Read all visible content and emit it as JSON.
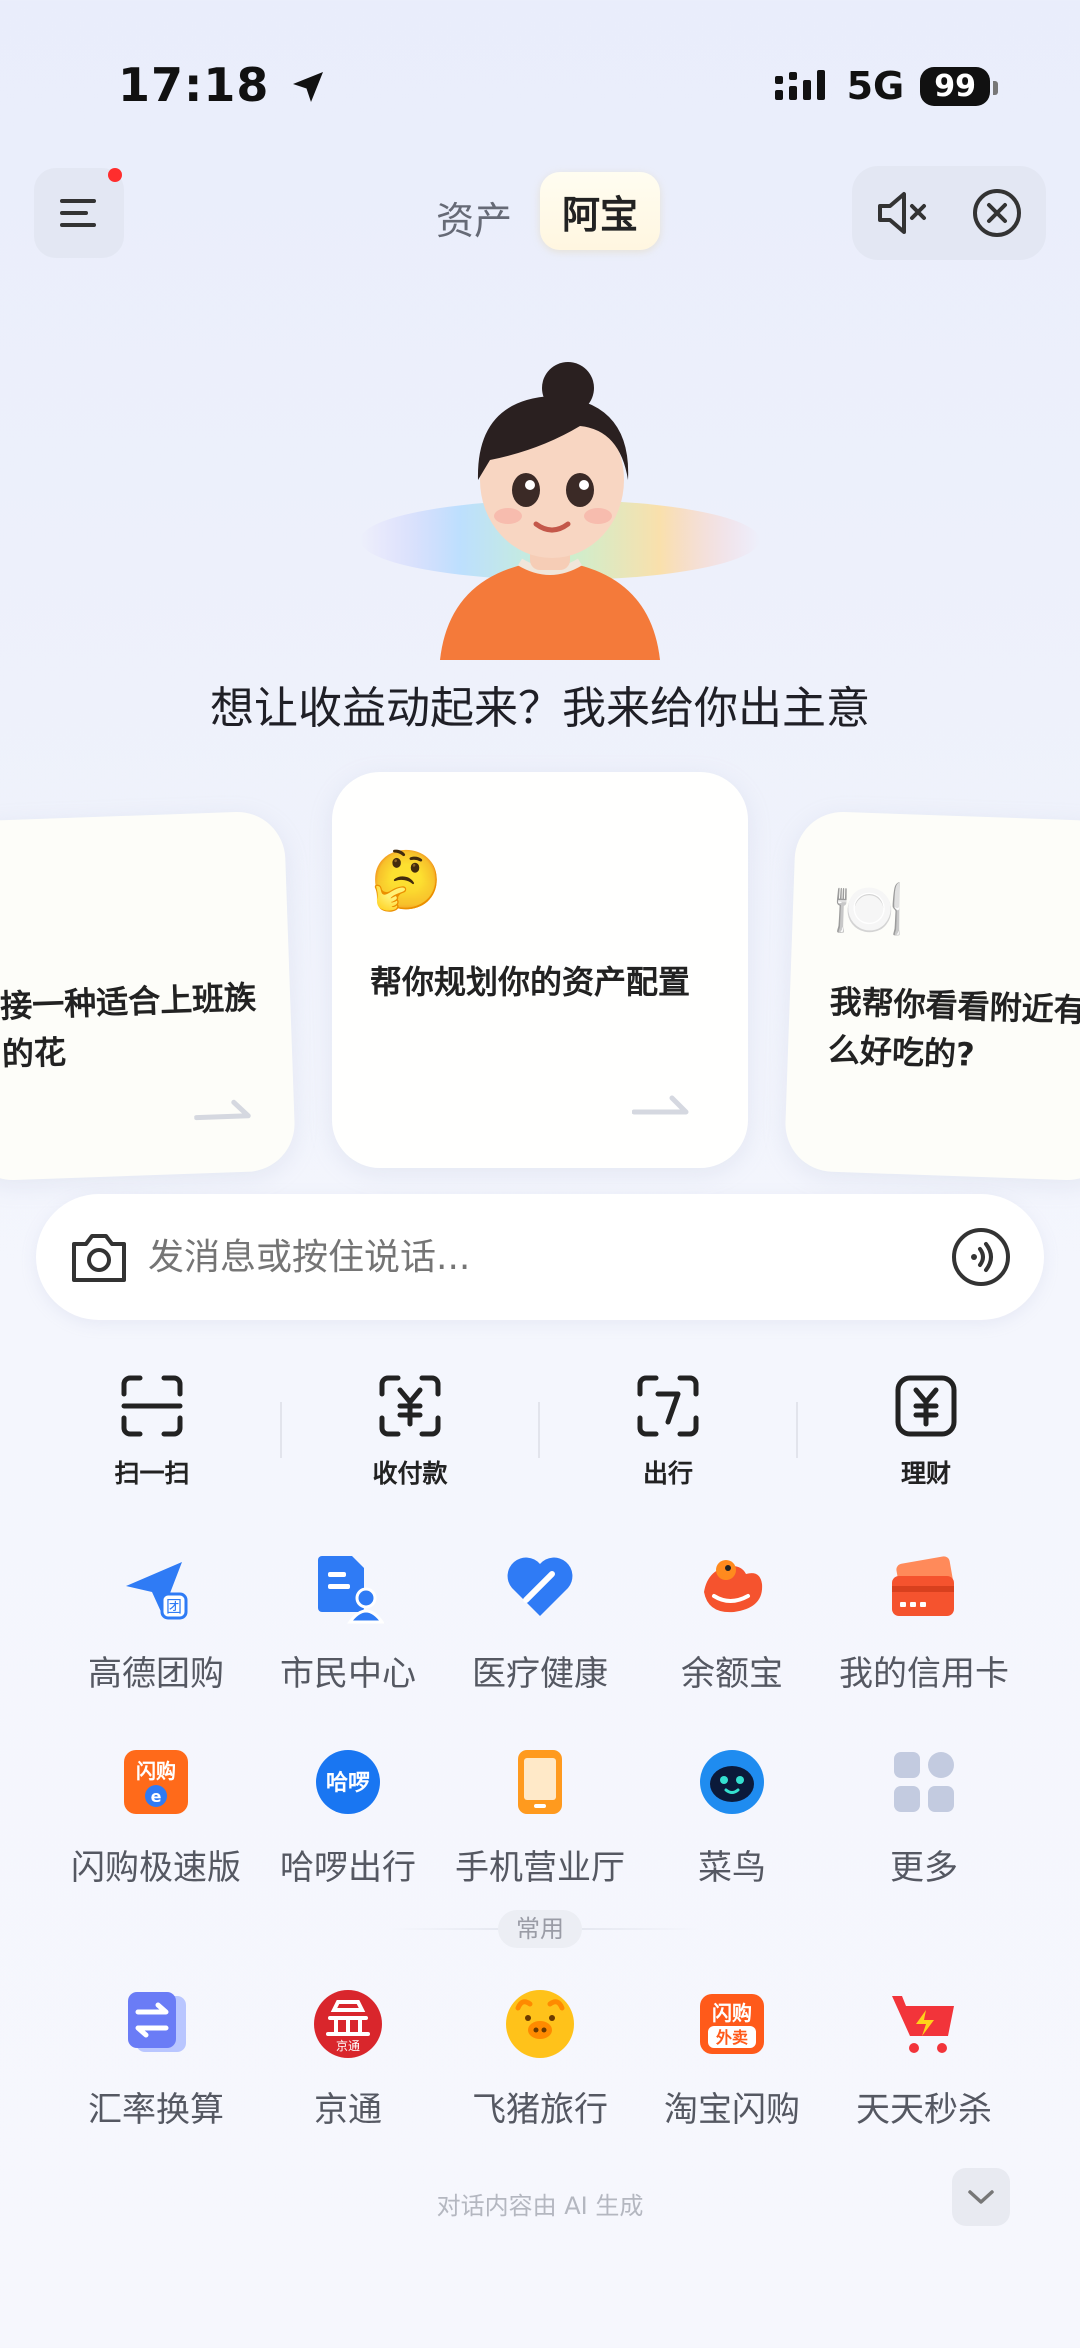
{
  "status_bar": {
    "time": "17:18",
    "network": "5G",
    "battery": "99"
  },
  "header": {
    "tabs": [
      {
        "label": "资产",
        "selected": false
      },
      {
        "label": "阿宝",
        "selected": true
      }
    ]
  },
  "assistant": {
    "headline": "想让收益动起来？我来给你出主意"
  },
  "cards": [
    {
      "text": "接一种适合上班族的花"
    },
    {
      "emoji": "🤔",
      "text": "帮你规划你的资产配置"
    },
    {
      "emoji": "🍽️",
      "text": "我帮你看看附近有什么好吃的?"
    }
  ],
  "input": {
    "placeholder": "发消息或按住说话..."
  },
  "quick_actions": [
    {
      "label": "扫一扫",
      "icon": "scan-icon"
    },
    {
      "label": "收付款",
      "icon": "payment-code-icon"
    },
    {
      "label": "出行",
      "icon": "transit-icon"
    },
    {
      "label": "理财",
      "icon": "wealth-icon"
    }
  ],
  "apps_row1": [
    {
      "label": "高德团购",
      "icon": "amap-group-buy-icon",
      "color": "#2f7bf5"
    },
    {
      "label": "市民中心",
      "icon": "citizen-center-icon",
      "color": "#2f7bf5"
    },
    {
      "label": "医疗健康",
      "icon": "health-icon",
      "color": "#2f7bf5"
    },
    {
      "label": "余额宝",
      "icon": "yuebao-icon",
      "color": "#f5532e"
    },
    {
      "label": "我的信用卡",
      "icon": "credit-card-icon",
      "color": "#f5532e"
    }
  ],
  "apps_row2": [
    {
      "label": "闪购极速版",
      "icon": "flash-buy-icon",
      "color": "#ff6a1a"
    },
    {
      "label": "哈啰出行",
      "icon": "hello-bike-icon",
      "color": "#1976f2"
    },
    {
      "label": "手机营业厅",
      "icon": "mobile-hall-icon",
      "color": "#ff9a1e"
    },
    {
      "label": "菜鸟",
      "icon": "cainiao-icon",
      "color": "#1f8cf0"
    },
    {
      "label": "更多",
      "icon": "more-apps-icon",
      "color": "#c3cbe0"
    }
  ],
  "common_label": "常用",
  "apps_row3": [
    {
      "label": "汇率换算",
      "icon": "exchange-rate-icon",
      "color": "#6a7cf6"
    },
    {
      "label": "京通",
      "icon": "jingtong-icon",
      "color": "#d9262c"
    },
    {
      "label": "飞猪旅行",
      "icon": "fliggy-icon",
      "color": "#ffc21a"
    },
    {
      "label": "淘宝闪购",
      "icon": "taobao-flash-icon",
      "color": "#ff5a1a"
    },
    {
      "label": "天天秒杀",
      "icon": "daily-flash-sale-icon",
      "color": "#f2343a"
    }
  ],
  "icon_text": {
    "group_buy_badge": "团",
    "flash_buy_top": "闪购",
    "flash_buy_bottom": "e",
    "hello": "哈啰",
    "jingtong_badge": "京通",
    "taobao_flash_top": "闪购",
    "taobao_flash_bottom": "外卖"
  },
  "footer": {
    "note": "对话内容由 AI 生成"
  }
}
